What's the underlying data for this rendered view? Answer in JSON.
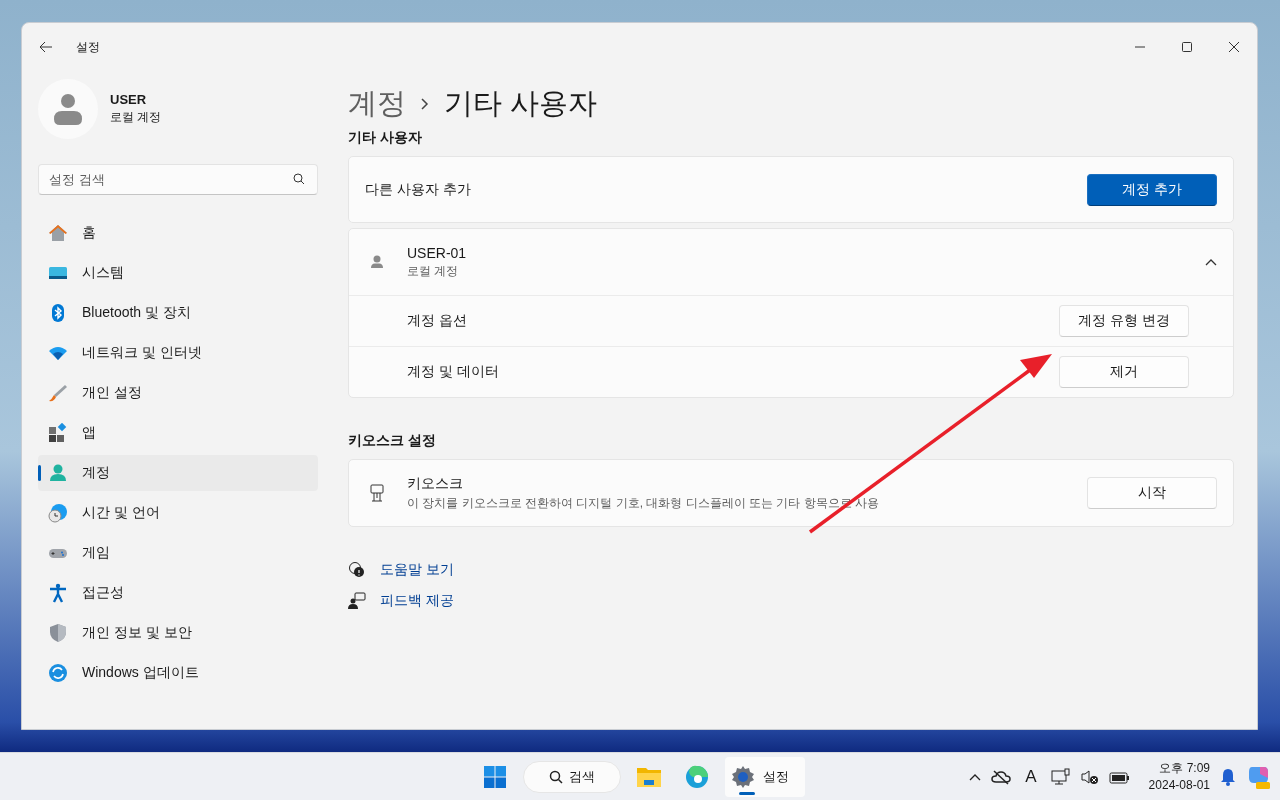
{
  "window": {
    "title": "설정"
  },
  "profile": {
    "name": "USER",
    "subtitle": "로컬 계정"
  },
  "search": {
    "placeholder": "설정 검색"
  },
  "nav": [
    {
      "label": "홈",
      "selected": false
    },
    {
      "label": "시스템",
      "selected": false
    },
    {
      "label": "Bluetooth 및 장치",
      "selected": false
    },
    {
      "label": "네트워크 및 인터넷",
      "selected": false
    },
    {
      "label": "개인 설정",
      "selected": false
    },
    {
      "label": "앱",
      "selected": false
    },
    {
      "label": "계정",
      "selected": true
    },
    {
      "label": "시간 및 언어",
      "selected": false
    },
    {
      "label": "게임",
      "selected": false
    },
    {
      "label": "접근성",
      "selected": false
    },
    {
      "label": "개인 정보 및 보안",
      "selected": false
    },
    {
      "label": "Windows 업데이트",
      "selected": false
    }
  ],
  "breadcrumb": [
    "계정",
    "기타 사용자"
  ],
  "other_users": {
    "heading": "기타 사용자",
    "add_label": "다른 사용자 추가",
    "add_button": "계정 추가",
    "user": {
      "name": "USER-01",
      "subtitle": "로컬 계정",
      "expanded": true,
      "rows": [
        {
          "label": "계정 옵션",
          "button": "계정 유형 변경"
        },
        {
          "label": "계정 및 데이터",
          "button": "제거"
        }
      ]
    }
  },
  "kiosk": {
    "heading": "키오스크 설정",
    "title": "키오스크",
    "description": "이 장치를 키오스크로 전환하여 디지털 기호, 대화형 디스플레이 또는 기타 항목으로 사용",
    "button": "시작"
  },
  "links": [
    "도움말 보기",
    "피드백 제공"
  ],
  "taskbar": {
    "search": "검색",
    "apps": [
      {
        "label": "설정",
        "selected": true
      }
    ],
    "ime": "A",
    "time": "오후 7:09",
    "date": "2024-08-01"
  }
}
